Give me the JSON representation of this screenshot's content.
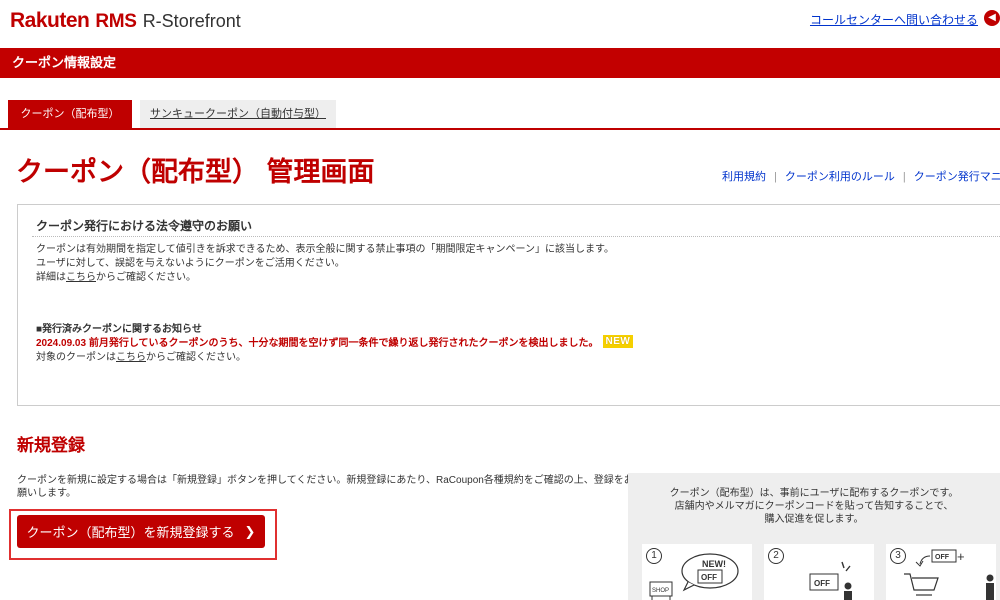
{
  "header": {
    "logo_brand": "Rakuten",
    "logo_rms": "RMS",
    "logo_sub": "R-Storefront",
    "callcenter_link": "コールセンターへ問い合わせる"
  },
  "red_bar": {
    "title": "クーポン情報設定"
  },
  "tabs": [
    {
      "label": "クーポン（配布型）",
      "active": true
    },
    {
      "label": "サンキュークーポン（自動付与型）",
      "active": false
    }
  ],
  "page_title": "クーポン（配布型） 管理画面",
  "help_links": {
    "terms": "利用規約",
    "rules": "クーポン利用のルール",
    "manual": "クーポン発行マニ"
  },
  "notice": {
    "title": "クーポン発行における法令遵守のお願い",
    "line1": "クーポンは有効期間を指定して値引きを訴求できるため、表示全般に関する禁止事項の「期間限定キャンペーン」に該当します。",
    "line2": "ユーザに対して、誤認を与えないようにクーポンをご活用ください。",
    "line3_prefix": "詳細は",
    "line3_link": "こちら",
    "line3_suffix": "からご確認ください。",
    "sub_title": "■発行済みクーポンに関するお知らせ",
    "alert": "2024.09.03 前月発行しているクーポンのうち、十分な期間を空けず同一条件で繰り返し発行されたクーポンを検出しました。",
    "new_badge": "NEW",
    "alert_sub_prefix": "対象のクーポンは",
    "alert_sub_link": "こちら",
    "alert_sub_suffix": "からご確認ください。"
  },
  "registration": {
    "title": "新規登録",
    "desc": "クーポンを新規に設定する場合は「新規登録」ボタンを押してください。新規登録にあたり、RaCoupon各種規約をご確認の上、登録をお願いします。",
    "button_label": "クーポン（配布型）を新規登録する",
    "button_chevron": "❯"
  },
  "info_panel": {
    "line1": "クーポン（配布型）は、事前にユーザに配布するクーポンです。",
    "line2": "店舗内やメルマガにクーポンコードを貼って告知することで、",
    "line3": "購入促進を促します。",
    "steps": [
      {
        "num": "1",
        "bubble": "NEW!",
        "ticket": "OFF",
        "shop": "SHOP"
      },
      {
        "num": "2",
        "ticket": "OFF"
      },
      {
        "num": "3",
        "ticket": "OFF",
        "plus": "+"
      }
    ]
  },
  "colors": {
    "brand_red": "#bf0000",
    "link_blue": "#0033cc",
    "new_badge_yellow": "#f5d000",
    "panel_gray": "#eeeeee"
  },
  "icons": {
    "callcenter": "arrow-left-circle-icon",
    "register_chevron": "chevron-right-icon"
  }
}
